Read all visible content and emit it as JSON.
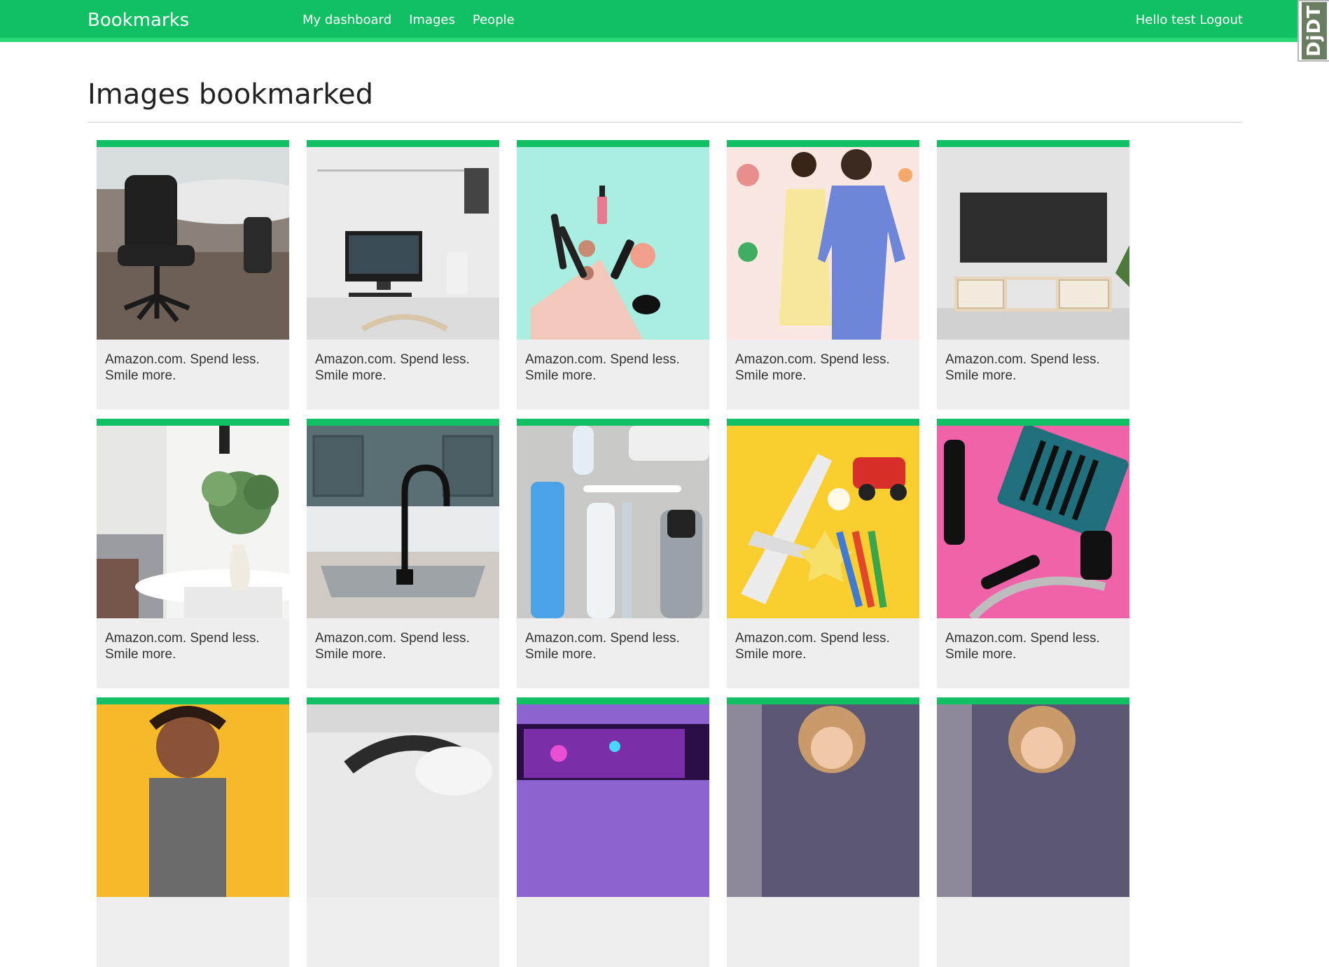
{
  "header": {
    "brand": "Bookmarks",
    "nav": [
      "My dashboard",
      "Images",
      "People"
    ],
    "greeting": "Hello test",
    "logout": "Logout",
    "accent": "#12c064"
  },
  "debug_toolbar": {
    "label": "DjDT"
  },
  "page": {
    "title": "Images bookmarked"
  },
  "images": [
    {
      "caption": "Amazon.com. Spend less. Smile more.",
      "icon": "office-chair"
    },
    {
      "caption": "Amazon.com. Spend less. Smile more.",
      "icon": "computer-desk"
    },
    {
      "caption": "Amazon.com. Spend less. Smile more.",
      "icon": "makeup"
    },
    {
      "caption": "Amazon.com. Spend less. Smile more.",
      "icon": "fashion"
    },
    {
      "caption": "Amazon.com. Spend less. Smile more.",
      "icon": "tv-stand"
    },
    {
      "caption": "Amazon.com. Spend less. Smile more.",
      "icon": "plant-vase"
    },
    {
      "caption": "Amazon.com. Spend less. Smile more.",
      "icon": "kitchen-faucet"
    },
    {
      "caption": "Amazon.com. Spend less. Smile more.",
      "icon": "toiletries"
    },
    {
      "caption": "Amazon.com. Spend less. Smile more.",
      "icon": "toys"
    },
    {
      "caption": "Amazon.com. Spend less. Smile more.",
      "icon": "tools"
    },
    {
      "caption": "",
      "icon": "fitness"
    },
    {
      "caption": "",
      "icon": "headphones"
    },
    {
      "caption": "",
      "icon": "gaming"
    },
    {
      "caption": "",
      "icon": "child"
    },
    {
      "caption": "",
      "icon": "child"
    }
  ]
}
